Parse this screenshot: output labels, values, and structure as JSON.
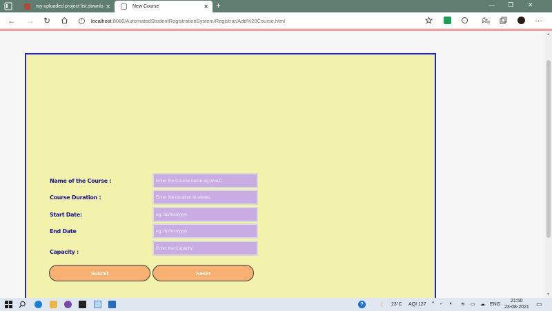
{
  "browser": {
    "tabs": [
      {
        "title": "my uploaded project list.downlo",
        "active": false
      },
      {
        "title": "New Course",
        "active": true
      }
    ],
    "address": {
      "host": "localhost",
      "path": ":8080/AutomatedStudentRegistrationSystem/Registrar/Add%20Course.html"
    }
  },
  "form": {
    "fields": [
      {
        "label": "Name of the Course :",
        "placeholder": "Enter the Course name eg java,C"
      },
      {
        "label": "Course Duration :",
        "placeholder": "Enter the duration in weeks"
      },
      {
        "label": "Start Date:",
        "placeholder": "eg. dd/mm/yyyy"
      },
      {
        "label": "End Date",
        "placeholder": "eg. dd/mm/yyyy"
      },
      {
        "label": "Capacity :",
        "placeholder": "Enter the Capacity"
      }
    ],
    "submit_label": "Submit",
    "reset_label": "Reset"
  },
  "taskbar": {
    "temperature": "23°C",
    "aqi": "AQI 127",
    "language": "ENG",
    "time": "21:50",
    "date": "23-08-2021"
  },
  "colors": {
    "panel_bg": "#f2f2ad",
    "panel_border": "#1f20e6",
    "label_text": "#1a1488",
    "field_bg": "#c8ace3",
    "button_bg": "#f7b173"
  }
}
